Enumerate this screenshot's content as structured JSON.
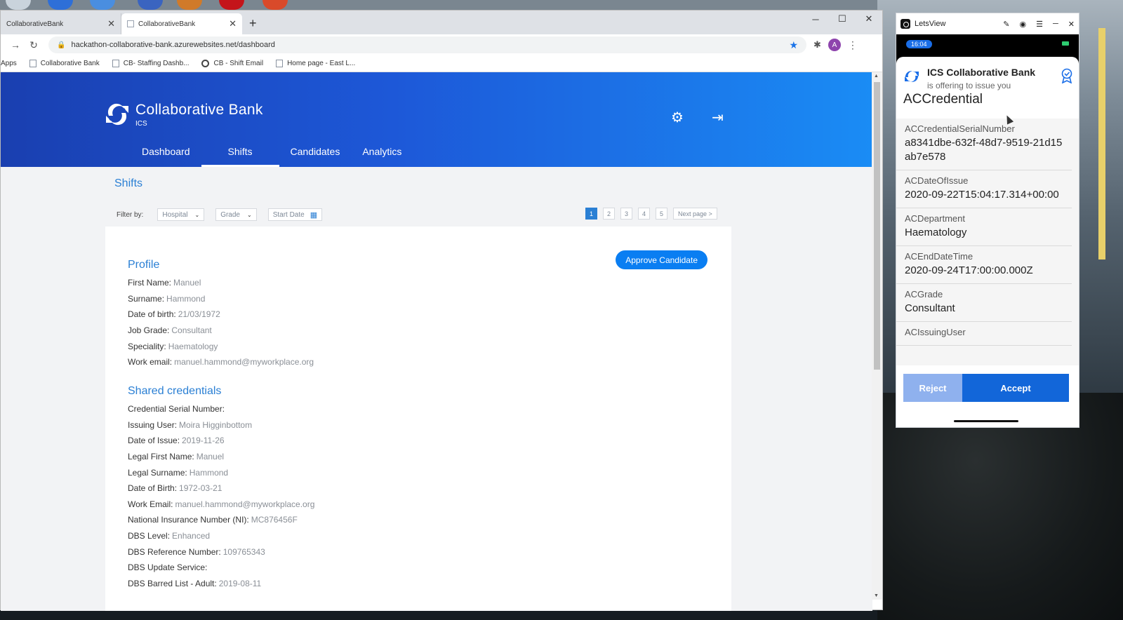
{
  "browser": {
    "tabs": [
      {
        "label": "CollaborativeBank",
        "active": false
      },
      {
        "label": "CollaborativeBank",
        "active": true
      }
    ],
    "url": "hackathon-collaborative-bank.azurewebsites.net/dashboard",
    "profile_initial": "A",
    "bookmarks": [
      "Apps",
      "Collaborative Bank",
      "CB- Staffing Dashb...",
      "CB - Shift Email",
      "Home page - East L..."
    ]
  },
  "app": {
    "brand_name": "Collaborative Bank",
    "brand_sub": "ICS",
    "nav": [
      "Dashboard",
      "Shifts",
      "Candidates",
      "Analytics"
    ],
    "active_nav": "Shifts",
    "page_title": "Shifts",
    "filter_label": "Filter by:",
    "filters": {
      "hospital": "Hospital",
      "grade": "Grade",
      "start_date": "Start Date"
    },
    "pages": [
      "1",
      "2",
      "3",
      "4",
      "5"
    ],
    "active_page": "1",
    "next_page": "Next page >",
    "approve_label": "Approve Candidate",
    "profile_heading": "Profile",
    "profile": [
      {
        "label": "First Name:",
        "value": "Manuel"
      },
      {
        "label": "Surname:",
        "value": "Hammond"
      },
      {
        "label": "Date of birth:",
        "value": "21/03/1972"
      },
      {
        "label": "Job Grade:",
        "value": "Consultant"
      },
      {
        "label": "Speciality:",
        "value": "Haematology"
      },
      {
        "label": "Work email:",
        "value": "manuel.hammond@myworkplace.org"
      }
    ],
    "credentials_heading": "Shared credentials",
    "credentials": [
      {
        "label": "Credential Serial Number:",
        "value": ""
      },
      {
        "label": "Issuing User:",
        "value": "Moira Higginbottom"
      },
      {
        "label": "Date of Issue:",
        "value": "2019-11-26"
      },
      {
        "label": "Legal First Name:",
        "value": "Manuel"
      },
      {
        "label": "Legal Surname:",
        "value": "Hammond"
      },
      {
        "label": "Date of Birth:",
        "value": "1972-03-21"
      },
      {
        "label": "Work Email:",
        "value": "manuel.hammond@myworkplace.org"
      },
      {
        "label": "National Insurance Number (NI):",
        "value": "MC876456F"
      },
      {
        "label": "DBS Level:",
        "value": "Enhanced"
      },
      {
        "label": "DBS Reference Number:",
        "value": "109765343"
      },
      {
        "label": "DBS Update Service:",
        "value": ""
      },
      {
        "label": "DBS Barred List - Adult:",
        "value": "2019-08-11"
      }
    ]
  },
  "letsview": {
    "window_title": "LetsView",
    "time": "16:04",
    "org": "ICS Collaborative Bank",
    "offer_text": "is offering to issue you",
    "credential_name": "ACCredential",
    "attributes": [
      {
        "key": "ACCredentialSerialNumber",
        "value": "a8341dbe-632f-48d7-9519-21d15ab7e578"
      },
      {
        "key": "ACDateOfIssue",
        "value": "2020-09-22T15:04:17.314+00:00"
      },
      {
        "key": "ACDepartment",
        "value": "Haematology"
      },
      {
        "key": "ACEndDateTime",
        "value": "2020-09-24T17:00:00.000Z"
      },
      {
        "key": "ACGrade",
        "value": "Consultant"
      },
      {
        "key": "ACIssuingUser",
        "value": ""
      }
    ],
    "reject_label": "Reject",
    "accept_label": "Accept"
  }
}
